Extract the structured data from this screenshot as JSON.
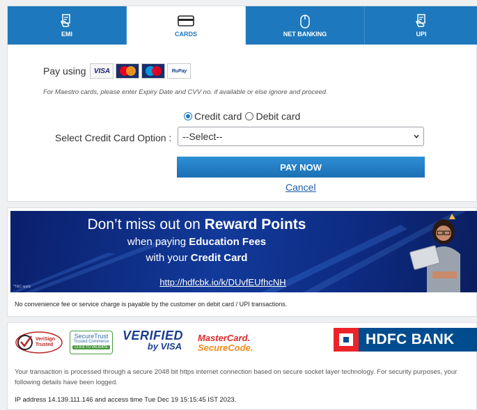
{
  "tabs": [
    {
      "label": "EMI",
      "icon": "emi-hand-icon",
      "active": false
    },
    {
      "label": "CARDS",
      "icon": "credit-card-icon",
      "active": true
    },
    {
      "label": "NET BANKING",
      "icon": "mouse-icon",
      "active": false
    },
    {
      "label": "UPI",
      "icon": "upi-hand-icon",
      "active": false
    }
  ],
  "payment": {
    "pay_using_label": "Pay using",
    "card_logos": [
      "VISA",
      "MasterCard",
      "Maestro",
      "RuPay"
    ],
    "maestro_note": "For Maestro cards, please enter Expiry Date and CVV no. if available or else ignore and proceed.",
    "card_type_options": [
      "Credit card",
      "Debit card"
    ],
    "card_type_selected": "Credit card",
    "select_label": "Select Credit Card Option :",
    "select_value": "--Select--",
    "pay_button": "PAY NOW",
    "cancel_link": "Cancel"
  },
  "banner": {
    "line1_plain": "Don’t miss out on",
    "line1_bold": "Reward Points",
    "line2_plain": "when paying",
    "line2_bold": "Education Fees",
    "line3_plain": "with your",
    "line3_bold": "Credit Card",
    "link": "http://hdfcbk.io/k/DUvfEUfhcNH",
    "tc": "*T&C apply"
  },
  "fee_note": "No convenience fee or service charge is payable by the customer on debit card / UPI transactions.",
  "security_badges": {
    "verisign_line1": "VeriSign",
    "verisign_line2": "Trusted",
    "securetrust_line1": "SecureTrust",
    "securetrust_line2": "Trusted Commerce",
    "securetrust_line3": "CLICK TO VALIDATE",
    "vbv_line1": "VERIFIED",
    "vbv_line2": "by VISA",
    "mc_line1": "MasterCard.",
    "mc_line2": "SecureCode.",
    "bank": "HDFC BANK"
  },
  "security_text": "Your transaction is processed through a secure 2048 bit https internet connection based on secure socket layer technology. For security purposes, your following details have been logged.",
  "ip_text": "IP address 14.139.111.146 and access time Tue Dec 19 15:15:45 IST 2023.",
  "colors": {
    "tab_blue": "#1d78bd",
    "button_blue": "#2f8fd6",
    "hdfc_red": "#ed232a",
    "hdfc_blue": "#004c8f"
  }
}
